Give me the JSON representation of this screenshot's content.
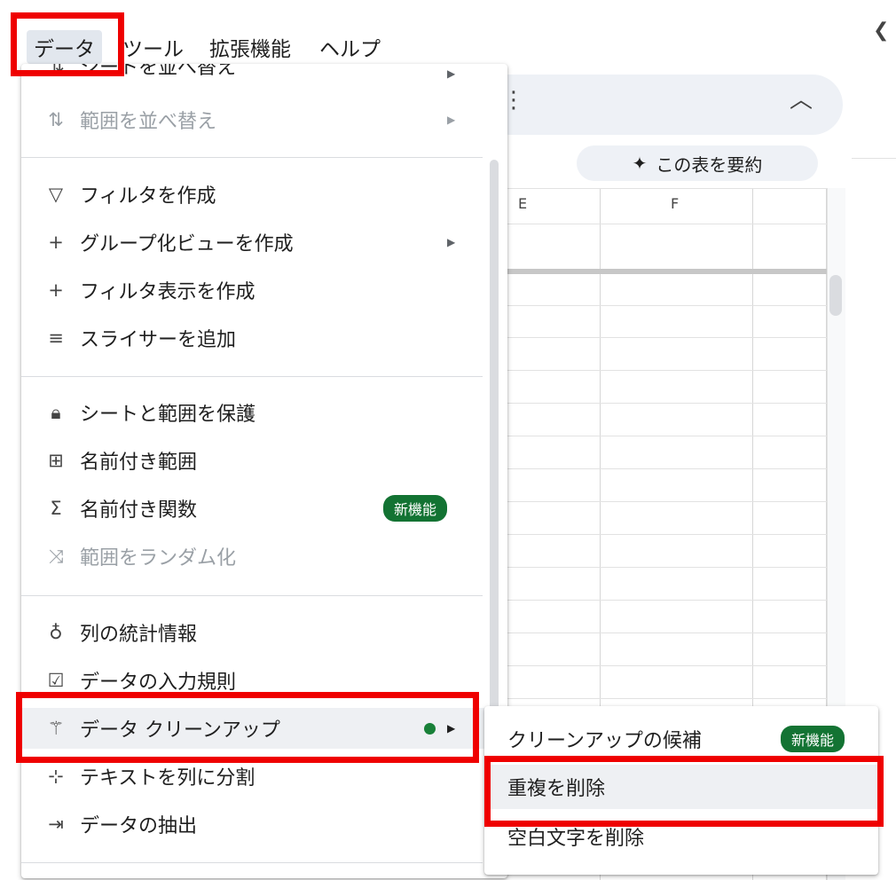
{
  "menubar": {
    "items": [
      {
        "label": "データ",
        "active": true
      },
      {
        "label": "ツール"
      },
      {
        "label": "拡張機能"
      },
      {
        "label": "ヘルプ"
      }
    ]
  },
  "data_menu": {
    "partial_top_item": "シートを並べ替え",
    "items": [
      {
        "label": "範囲を並べ替え",
        "icon": "sort-icon",
        "disabled": true,
        "submenu": true
      },
      {
        "label": "フィルタを作成",
        "icon": "filter-icon"
      },
      {
        "label": "グループ化ビューを作成",
        "icon": "plus-icon",
        "submenu": true
      },
      {
        "label": "フィルタ表示を作成",
        "icon": "plus-icon"
      },
      {
        "label": "スライサーを追加",
        "icon": "slicer-icon"
      },
      {
        "label": "シートと範囲を保護",
        "icon": "lock-icon"
      },
      {
        "label": "名前付き範囲",
        "icon": "named-range-icon"
      },
      {
        "label": "名前付き関数",
        "icon": "sigma-icon",
        "badge": "新機能"
      },
      {
        "label": "範囲をランダム化",
        "icon": "shuffle-icon",
        "disabled": true
      },
      {
        "label": "列の統計情報",
        "icon": "lightbulb-icon"
      },
      {
        "label": "データの入力規則",
        "icon": "validation-icon"
      },
      {
        "label": "データ クリーンアップ",
        "icon": "magic-wand-icon",
        "submenu": true,
        "highlighted": true
      },
      {
        "label": "テキストを列に分割",
        "icon": "split-icon"
      },
      {
        "label": "データの抽出",
        "icon": "extract-icon"
      }
    ]
  },
  "cleanup_submenu": {
    "items": [
      {
        "label": "クリーンアップの候補",
        "badge": "新機能"
      },
      {
        "label": "重複を削除",
        "highlighted": true
      },
      {
        "label": "空白文字を削除"
      }
    ]
  },
  "sheet": {
    "summarize_chip": "この表を要約",
    "columns": [
      "E",
      "F"
    ]
  },
  "colors": {
    "badge_green": "#137333",
    "annotation_red": "#ef0000",
    "dot_green": "#188038"
  }
}
